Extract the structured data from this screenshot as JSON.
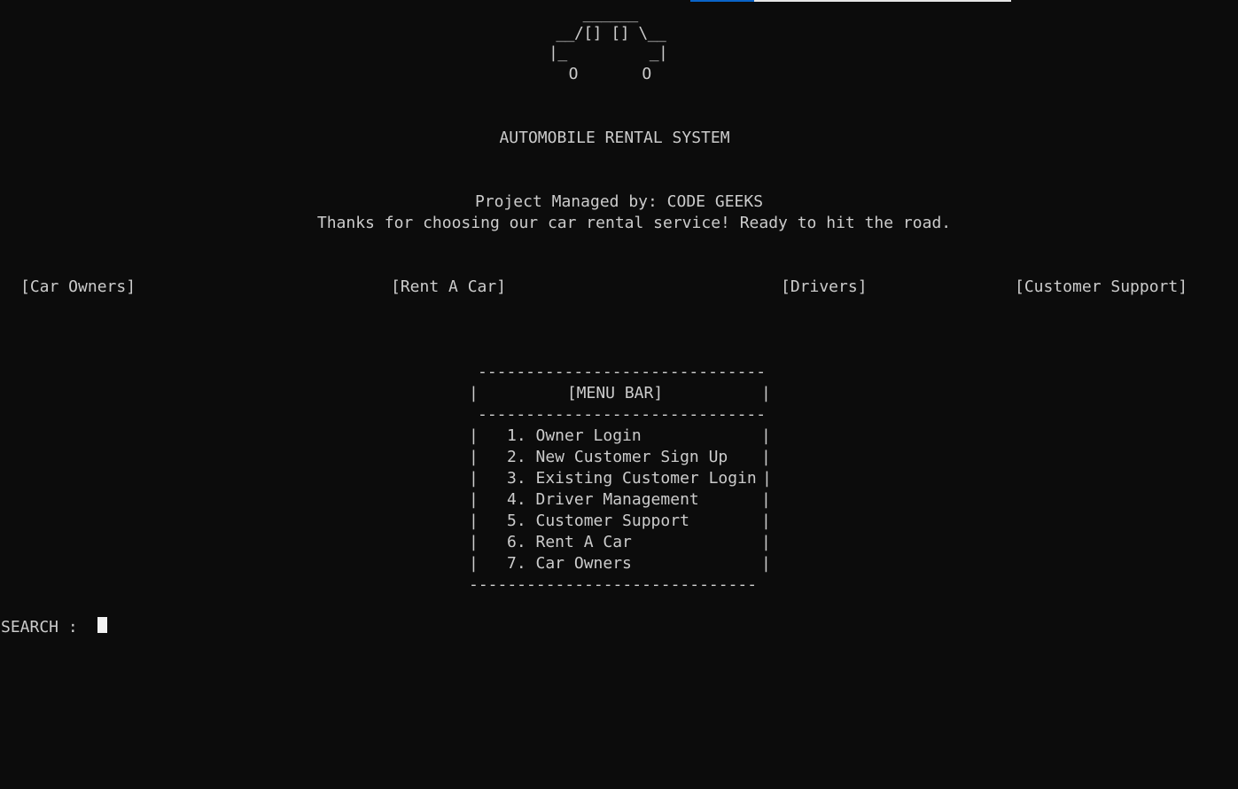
{
  "progress": {
    "fraction": 0.2,
    "track_color": "#e6e6e6",
    "fill_color": "#0a64c8"
  },
  "ascii_art": {
    "line1": "  ______",
    "line2": " __/[] [] \\__",
    "line3": "|_         _|",
    "line4": "  O       O"
  },
  "header": {
    "title": "AUTOMOBILE RENTAL SYSTEM",
    "managed_by": "Project Managed by: CODE GEEKS",
    "tagline": "Thanks for choosing our car rental service! Ready to hit the road."
  },
  "nav": {
    "car_owners": "[Car Owners]",
    "rent_a_car": "[Rent A Car]",
    "drivers": "[Drivers]",
    "customer_support": "[Customer Support]"
  },
  "menu": {
    "dashes_top": "------------------------------",
    "dashes_mid": "------------------------------",
    "dashes_bottom": "------------------------------",
    "pipe": "|",
    "title": "[MENU BAR]",
    "items": [
      {
        "label": "1. Owner Login"
      },
      {
        "label": "2. New Customer Sign Up"
      },
      {
        "label": "3. Existing Customer Login"
      },
      {
        "label": "4. Driver Management"
      },
      {
        "label": "5. Customer Support"
      },
      {
        "label": "6. Rent A Car"
      },
      {
        "label": "7. Car Owners"
      }
    ]
  },
  "search": {
    "label": "SEARCH :",
    "value": ""
  },
  "colors": {
    "background": "#0c0c0c",
    "text": "#cccccc",
    "cursor": "#f2f2f2"
  }
}
